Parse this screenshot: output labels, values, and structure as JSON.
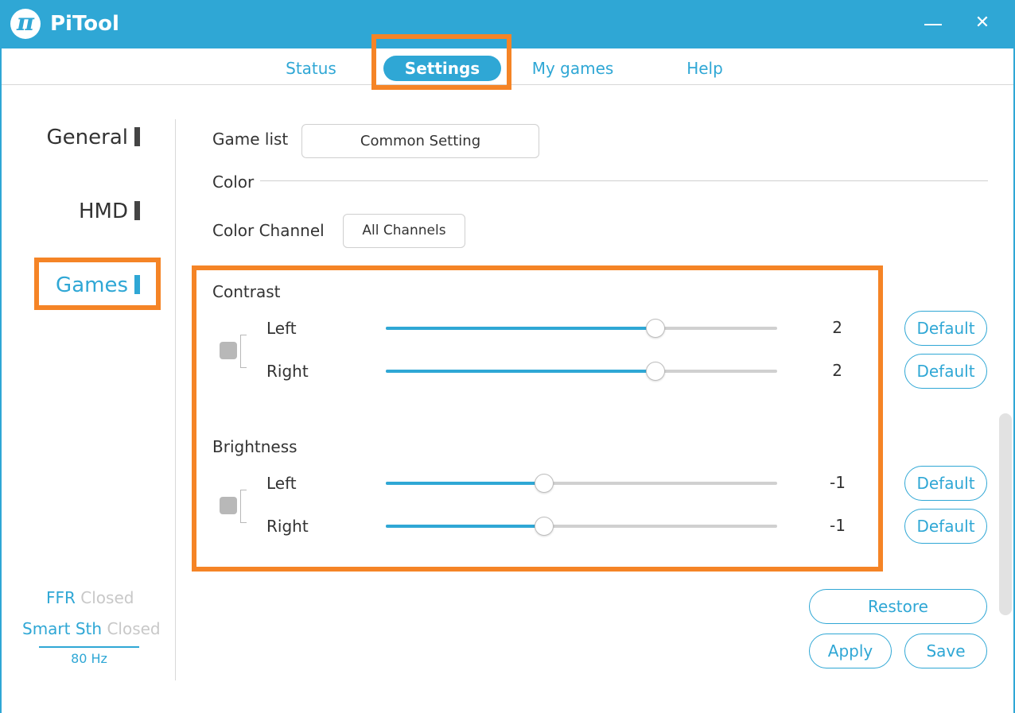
{
  "window": {
    "app_title": "PiTool",
    "logo_glyph": "π",
    "close_glyph": "✕"
  },
  "nav": {
    "tabs": [
      {
        "label": "Status",
        "active": false
      },
      {
        "label": "Settings",
        "active": true
      },
      {
        "label": "My games",
        "active": false
      },
      {
        "label": "Help",
        "active": false
      }
    ]
  },
  "sidebar": {
    "items": [
      {
        "label": "General",
        "active": false
      },
      {
        "label": "HMD",
        "active": false
      },
      {
        "label": "Games",
        "active": true
      }
    ],
    "status": {
      "ffr_label": "FFR",
      "ffr_value": "Closed",
      "smart_label": "Smart Sth",
      "smart_value": "Closed",
      "refresh_rate": "80 Hz"
    }
  },
  "settings": {
    "game_list_label": "Game list",
    "game_list_value": "Common Setting",
    "color_section": "Color",
    "color_channel_label": "Color Channel",
    "color_channel_value": "All Channels",
    "contrast": {
      "title": "Contrast",
      "left_label": "Left",
      "left_value": "2",
      "left_fraction": 0.69,
      "right_label": "Right",
      "right_value": "2",
      "right_fraction": 0.69
    },
    "brightness": {
      "title": "Brightness",
      "left_label": "Left",
      "left_value": "-1",
      "left_fraction": 0.405,
      "right_label": "Right",
      "right_value": "-1",
      "right_fraction": 0.405
    },
    "default_label": "Default",
    "restore_label": "Restore",
    "apply_label": "Apply",
    "save_label": "Save"
  },
  "colors": {
    "accent": "#2fa7d5",
    "highlight": "#f58426"
  }
}
